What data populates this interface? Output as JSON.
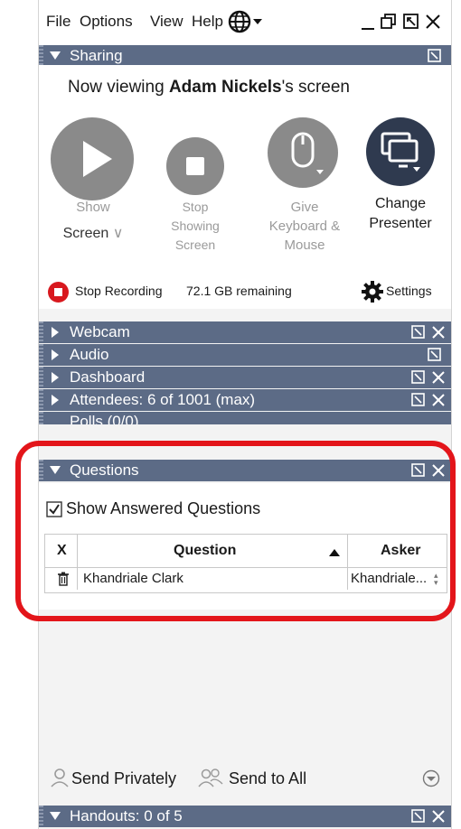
{
  "menubar": {
    "file": "File",
    "options": "Options",
    "view": "View",
    "help": "Help"
  },
  "sharing": {
    "title": "Sharing",
    "viewing_prefix": "Now viewing ",
    "presenter_name": "Adam Nickels",
    "viewing_suffix": "'s screen",
    "show_screen_line1": "Show",
    "show_screen_line2": "Screen",
    "stop_showing_line1": "Stop",
    "stop_showing_line2": "Showing",
    "stop_showing_line3": "Screen",
    "give_kb_line1": "Give",
    "give_kb_line2": "Keyboard &",
    "give_kb_line3": "Mouse",
    "change_presenter_line1": "Change",
    "change_presenter_line2": "Presenter",
    "stop_recording": "Stop Recording",
    "remaining": "72.1 GB remaining",
    "settings": "Settings"
  },
  "sections": {
    "webcam": "Webcam",
    "audio": "Audio",
    "dashboard": "Dashboard",
    "attendees": "Attendees:  6 of 1001 (max)",
    "polls": "Polls (0/0)",
    "questions": "Questions",
    "handouts": "Handouts: 0 of 5"
  },
  "questions": {
    "show_answered": "Show Answered Questions",
    "show_answered_checked": true,
    "columns": {
      "x": "X",
      "question": "Question",
      "asker": "Asker"
    },
    "rows": [
      {
        "question": "Khandriale Clark",
        "asker": "Khandriale..."
      }
    ],
    "send_privately": "Send Privately",
    "send_to_all": "Send to All"
  },
  "colors": {
    "section_header": "#5c6b86",
    "highlight": "#e3151a",
    "button_gray": "#8a8a8a",
    "presenter_dark": "#2f3a4f",
    "record_red": "#d8181e"
  }
}
